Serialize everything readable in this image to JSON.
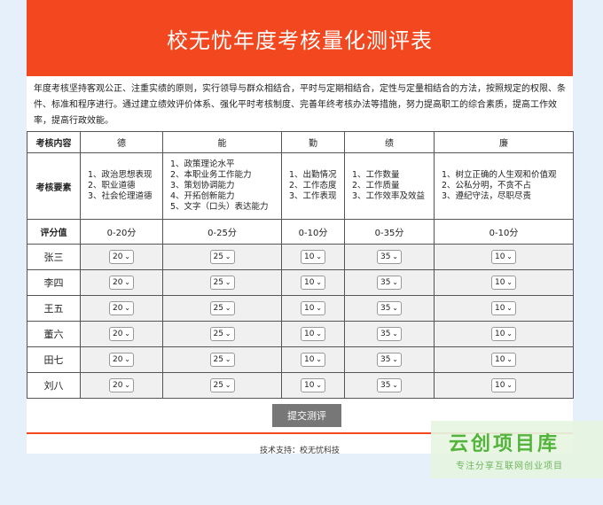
{
  "title": "校无忧年度考核量化测评表",
  "intro": "年度考核坚持客观公正、注重实绩的原则，实行领导与群众相结合，平时与定期相结合，定性与定量相结合的方法，按照规定的权限、条件、标准和程序进行。通过建立绩效评价体系、强化平时考核制度、完善年终考核办法等措施，努力提高职工的综合素质，提高工作效率，提高行政效能。",
  "table": {
    "corner_label": "考核内容",
    "req_label": "考核要素",
    "score_label": "评分值",
    "columns": [
      {
        "name": "德",
        "items": [
          "1、政治思想表现",
          "2、职业道德",
          "3、社会伦理道德"
        ],
        "range": "0-20分"
      },
      {
        "name": "能",
        "items": [
          "1、政策理论水平",
          "2、本职业务工作能力",
          "3、策划协调能力",
          "4、开拓创新能力",
          "5、文字（口头）表达能力"
        ],
        "range": "0-25分"
      },
      {
        "name": "勤",
        "items": [
          "1、出勤情况",
          "2、工作态度",
          "3、工作表现"
        ],
        "range": "0-10分"
      },
      {
        "name": "绩",
        "items": [
          "1、工作数量",
          "2、工作质量",
          "3、工作效率及效益"
        ],
        "range": "0-35分"
      },
      {
        "name": "廉",
        "items": [
          "1、树立正确的人生观和价值观",
          "2、公私分明，不贪不占",
          "3、遵纪守法，尽职尽责"
        ],
        "range": "0-10分"
      }
    ],
    "people": [
      {
        "name": "张三",
        "scores": [
          "20",
          "25",
          "10",
          "35",
          "10"
        ]
      },
      {
        "name": "李四",
        "scores": [
          "20",
          "25",
          "10",
          "35",
          "10"
        ]
      },
      {
        "name": "王五",
        "scores": [
          "20",
          "25",
          "10",
          "35",
          "10"
        ]
      },
      {
        "name": "董六",
        "scores": [
          "20",
          "25",
          "10",
          "35",
          "10"
        ]
      },
      {
        "name": "田七",
        "scores": [
          "20",
          "25",
          "10",
          "35",
          "10"
        ]
      },
      {
        "name": "刘八",
        "scores": [
          "20",
          "25",
          "10",
          "35",
          "10"
        ]
      }
    ]
  },
  "submit_label": "提交测评",
  "support_text": "技术支持：校无忧科技",
  "watermark": {
    "main": "云创项目库",
    "sub": "专注分享互联网创业项目"
  },
  "colors": {
    "brand": "#f2471f",
    "page_bg": "#e6f0fb",
    "button": "#777777"
  },
  "icons": {
    "select_arrow": "chevron-down-icon"
  }
}
